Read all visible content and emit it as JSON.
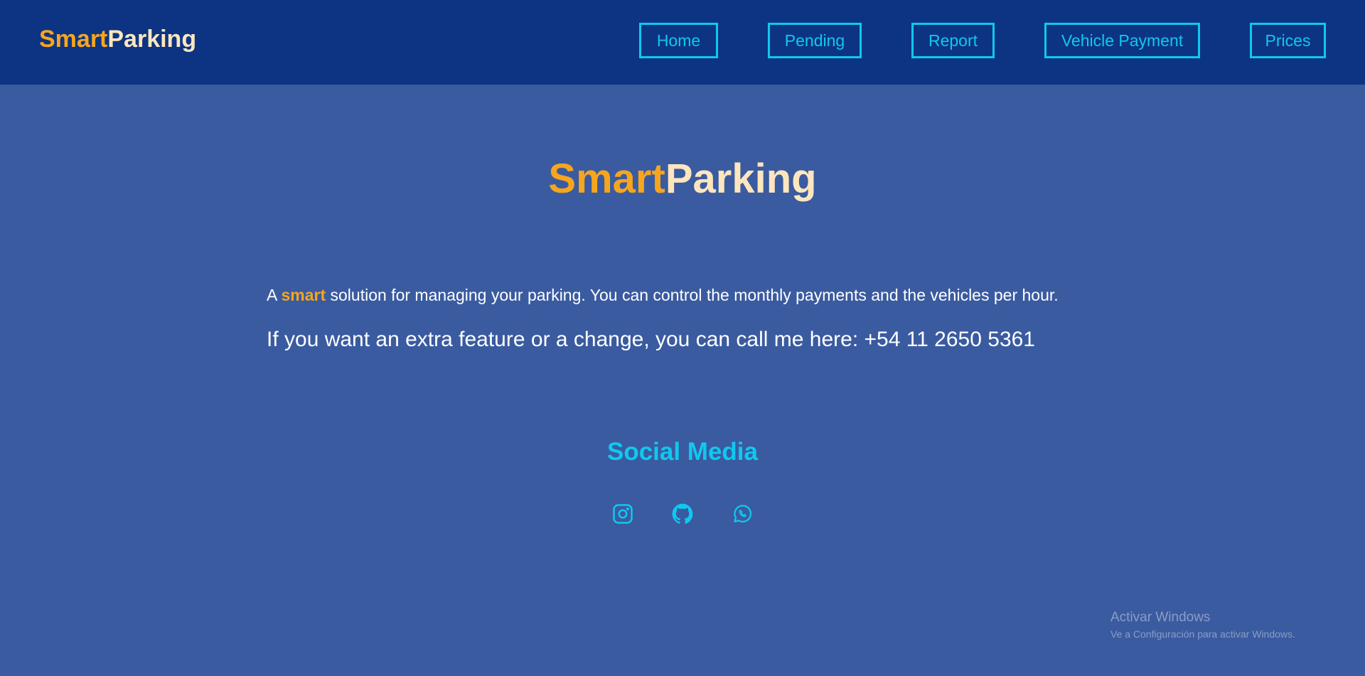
{
  "header": {
    "logo_part1": "Smart",
    "logo_part2": "Parking",
    "nav": {
      "home": "Home",
      "pending": "Pending",
      "report": "Report",
      "vehicle_payment": "Vehicle Payment",
      "prices": "Prices"
    }
  },
  "main": {
    "title_part1": "Smart",
    "title_part2": "Parking",
    "intro_prefix": "A ",
    "intro_highlight": "smart",
    "intro_suffix": " solution for managing your parking. You can control the monthly payments and the vehicles per hour.",
    "contact": "If you want an extra feature or a change, you can call me here: +54 11 2650 5361",
    "social_title": "Social Media",
    "social_icons": [
      "instagram-icon",
      "github-icon",
      "whatsapp-icon"
    ]
  },
  "watermark": {
    "line1": "Activar Windows",
    "line2": "Ve a Configuración para activar Windows."
  },
  "colors": {
    "header_bg": "#0d3482",
    "page_bg": "#3a5ba0",
    "accent_orange": "#f7a51e",
    "accent_cream": "#fde6bd",
    "accent_cyan": "#10c8ef"
  }
}
